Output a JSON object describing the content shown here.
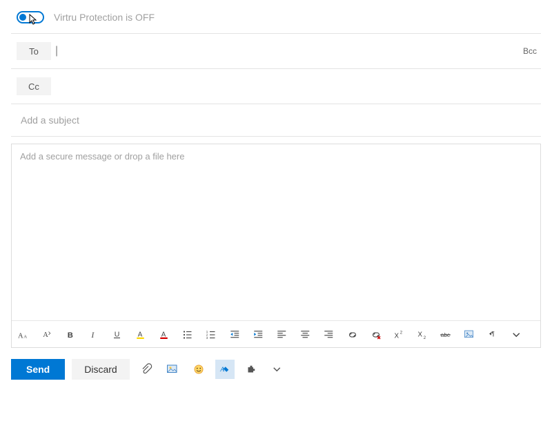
{
  "virtru": {
    "status_text": "Virtru Protection is OFF",
    "toggle_state": "off"
  },
  "recipients": {
    "to_label": "To",
    "cc_label": "Cc",
    "bcc_label": "Bcc",
    "to_value": "",
    "cc_value": ""
  },
  "subject": {
    "placeholder": "Add a subject",
    "value": ""
  },
  "body": {
    "placeholder": "Add a secure message or drop a file here",
    "value": ""
  },
  "format_toolbar": {
    "items": [
      "font-size",
      "font-style",
      "bold",
      "italic",
      "underline",
      "highlight-color",
      "font-color",
      "bulleted-list",
      "numbered-list",
      "outdent",
      "indent",
      "align-left",
      "align-center",
      "align-right",
      "insert-link",
      "remove-link",
      "superscript",
      "subscript",
      "strikethrough",
      "insert-image",
      "text-direction",
      "chevron-down"
    ]
  },
  "actions": {
    "send_label": "Send",
    "discard_label": "Discard"
  },
  "colors": {
    "accent": "#0078d4"
  }
}
